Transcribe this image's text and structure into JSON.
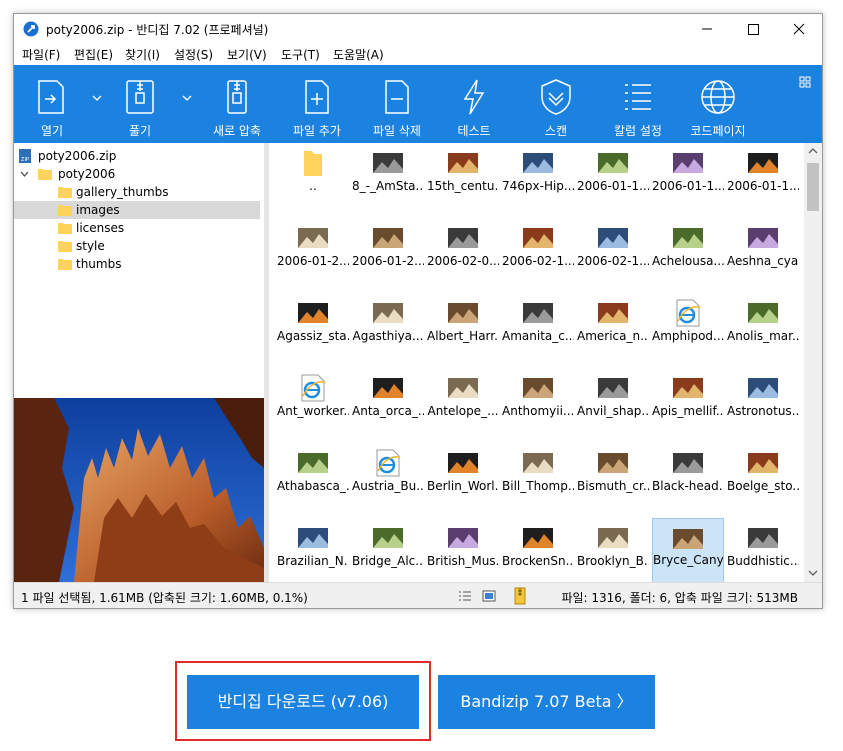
{
  "window": {
    "title": "poty2006.zip - 반디집 7.02 (프로페셔널)",
    "menu": [
      "파일(F)",
      "편집(E)",
      "찾기(I)",
      "설정(S)",
      "보기(V)",
      "도구(T)",
      "도움말(A)"
    ]
  },
  "toolbar": {
    "buttons": [
      {
        "label": "열기",
        "icon": "open-archive-icon"
      },
      {
        "label": "풀기",
        "icon": "extract-icon"
      },
      {
        "label": "새로 압축",
        "icon": "new-archive-icon"
      },
      {
        "label": "파일 추가",
        "icon": "add-file-icon"
      },
      {
        "label": "파일 삭제",
        "icon": "delete-file-icon"
      },
      {
        "label": "테스트",
        "icon": "test-icon"
      },
      {
        "label": "스캔",
        "icon": "scan-shield-icon"
      },
      {
        "label": "칼럼 설정",
        "icon": "column-settings-icon"
      },
      {
        "label": "코드페이지",
        "icon": "codepage-globe-icon"
      }
    ]
  },
  "tree": {
    "root": "poty2006.zip",
    "folder": "poty2006",
    "children": [
      "gallery_thumbs",
      "images",
      "licenses",
      "style",
      "thumbs"
    ],
    "selected": "images"
  },
  "files": [
    "..",
    "8_-_AmSta...",
    "15th_centu...",
    "746px-Hip...",
    "2006-01-1...",
    "2006-01-1...",
    "2006-01-1...",
    "2006-01-2...",
    "2006-01-2...",
    "2006-02-0...",
    "2006-02-1...",
    "2006-02-1...",
    "Achelousa...",
    "Aeshna_cya...",
    "Agassiz_sta...",
    "Agasthiya...",
    "Albert_Harr...",
    "Amanita_c...",
    "America_n...",
    "Amphipod...",
    "Anolis_mar...",
    "Ant_worker...",
    "Anta_orca_...",
    "Antelope_...",
    "Anthomyii...",
    "Anvil_shap...",
    "Apis_mellif...",
    "Astronotus...",
    "Athabasca_...",
    "Austria_Bu...",
    "Berlin_Worl...",
    "Bill_Thomp...",
    "Bismuth_cr...",
    "Black-head...",
    "Boelge_sto...",
    "Brazilian_N...",
    "Bridge_Alc...",
    "British_Mus...",
    "BrockenSn...",
    "Brooklyn_B...",
    "Bryce_Canyon_Hoodoos_i",
    "Buddhistic..."
  ],
  "selected_file_index": 40,
  "status": {
    "left": "1 파일 선택됨, 1.61MB (압축된 크기: 1.60MB, 0.1%)",
    "right": "파일: 1316, 폴더: 6, 압축 파일 크기: 513MB"
  },
  "buttons": {
    "download": "반디집 다운로드 (v7.06)",
    "beta": "Bandizip 7.07 Beta 〉"
  },
  "colors": {
    "accent": "#1c82e0",
    "highlight": "#e02b2b"
  }
}
